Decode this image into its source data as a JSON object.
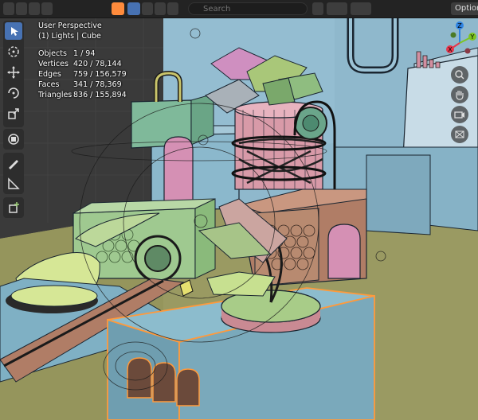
{
  "header": {
    "search_placeholder": "Search",
    "options_label": "Options"
  },
  "viewport": {
    "view_name": "User Perspective",
    "collection_label": "(1) Lights | Cube",
    "stats": [
      {
        "label": "Objects",
        "value": "1 / 94"
      },
      {
        "label": "Vertices",
        "value": "420 / 78,144"
      },
      {
        "label": "Edges",
        "value": "759 / 156,579"
      },
      {
        "label": "Faces",
        "value": "341 / 78,369"
      },
      {
        "label": "Triangles",
        "value": "836 / 155,894"
      }
    ]
  },
  "toolbar": {
    "tools": [
      {
        "icon": "select-box-icon",
        "active": true
      },
      {
        "icon": "cursor-icon",
        "active": false
      },
      {
        "icon": "move-icon",
        "active": false
      },
      {
        "icon": "rotate-icon",
        "active": false
      },
      {
        "icon": "scale-icon",
        "active": false
      },
      {
        "icon": "transform-icon",
        "active": false
      },
      {
        "icon": "annotate-icon",
        "active": false
      },
      {
        "icon": "measure-icon",
        "active": false
      },
      {
        "icon": "add-cube-icon",
        "active": false
      }
    ]
  },
  "gizmo": {
    "axes": [
      {
        "label": "X",
        "color": "#e5364b"
      },
      {
        "label": "Y",
        "color": "#7dc522"
      },
      {
        "label": "Z",
        "color": "#2f84e3"
      }
    ]
  },
  "colors": {
    "selection_outline": "#ff9a3c",
    "active_button": "#4772b3",
    "wall": "#8fb8cc",
    "floor": "#9a9a62"
  }
}
